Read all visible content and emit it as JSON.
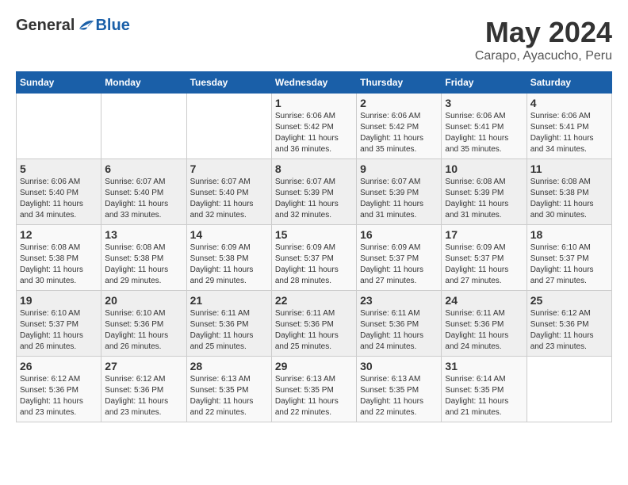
{
  "header": {
    "logo": {
      "general": "General",
      "blue": "Blue"
    },
    "title": "May 2024",
    "subtitle": "Carapo, Ayacucho, Peru"
  },
  "weekdays": [
    "Sunday",
    "Monday",
    "Tuesday",
    "Wednesday",
    "Thursday",
    "Friday",
    "Saturday"
  ],
  "weeks": [
    [
      {
        "day": "",
        "info": ""
      },
      {
        "day": "",
        "info": ""
      },
      {
        "day": "",
        "info": ""
      },
      {
        "day": "1",
        "info": "Sunrise: 6:06 AM\nSunset: 5:42 PM\nDaylight: 11 hours\nand 36 minutes."
      },
      {
        "day": "2",
        "info": "Sunrise: 6:06 AM\nSunset: 5:42 PM\nDaylight: 11 hours\nand 35 minutes."
      },
      {
        "day": "3",
        "info": "Sunrise: 6:06 AM\nSunset: 5:41 PM\nDaylight: 11 hours\nand 35 minutes."
      },
      {
        "day": "4",
        "info": "Sunrise: 6:06 AM\nSunset: 5:41 PM\nDaylight: 11 hours\nand 34 minutes."
      }
    ],
    [
      {
        "day": "5",
        "info": "Sunrise: 6:06 AM\nSunset: 5:40 PM\nDaylight: 11 hours\nand 34 minutes."
      },
      {
        "day": "6",
        "info": "Sunrise: 6:07 AM\nSunset: 5:40 PM\nDaylight: 11 hours\nand 33 minutes."
      },
      {
        "day": "7",
        "info": "Sunrise: 6:07 AM\nSunset: 5:40 PM\nDaylight: 11 hours\nand 32 minutes."
      },
      {
        "day": "8",
        "info": "Sunrise: 6:07 AM\nSunset: 5:39 PM\nDaylight: 11 hours\nand 32 minutes."
      },
      {
        "day": "9",
        "info": "Sunrise: 6:07 AM\nSunset: 5:39 PM\nDaylight: 11 hours\nand 31 minutes."
      },
      {
        "day": "10",
        "info": "Sunrise: 6:08 AM\nSunset: 5:39 PM\nDaylight: 11 hours\nand 31 minutes."
      },
      {
        "day": "11",
        "info": "Sunrise: 6:08 AM\nSunset: 5:38 PM\nDaylight: 11 hours\nand 30 minutes."
      }
    ],
    [
      {
        "day": "12",
        "info": "Sunrise: 6:08 AM\nSunset: 5:38 PM\nDaylight: 11 hours\nand 30 minutes."
      },
      {
        "day": "13",
        "info": "Sunrise: 6:08 AM\nSunset: 5:38 PM\nDaylight: 11 hours\nand 29 minutes."
      },
      {
        "day": "14",
        "info": "Sunrise: 6:09 AM\nSunset: 5:38 PM\nDaylight: 11 hours\nand 29 minutes."
      },
      {
        "day": "15",
        "info": "Sunrise: 6:09 AM\nSunset: 5:37 PM\nDaylight: 11 hours\nand 28 minutes."
      },
      {
        "day": "16",
        "info": "Sunrise: 6:09 AM\nSunset: 5:37 PM\nDaylight: 11 hours\nand 27 minutes."
      },
      {
        "day": "17",
        "info": "Sunrise: 6:09 AM\nSunset: 5:37 PM\nDaylight: 11 hours\nand 27 minutes."
      },
      {
        "day": "18",
        "info": "Sunrise: 6:10 AM\nSunset: 5:37 PM\nDaylight: 11 hours\nand 27 minutes."
      }
    ],
    [
      {
        "day": "19",
        "info": "Sunrise: 6:10 AM\nSunset: 5:37 PM\nDaylight: 11 hours\nand 26 minutes."
      },
      {
        "day": "20",
        "info": "Sunrise: 6:10 AM\nSunset: 5:36 PM\nDaylight: 11 hours\nand 26 minutes."
      },
      {
        "day": "21",
        "info": "Sunrise: 6:11 AM\nSunset: 5:36 PM\nDaylight: 11 hours\nand 25 minutes."
      },
      {
        "day": "22",
        "info": "Sunrise: 6:11 AM\nSunset: 5:36 PM\nDaylight: 11 hours\nand 25 minutes."
      },
      {
        "day": "23",
        "info": "Sunrise: 6:11 AM\nSunset: 5:36 PM\nDaylight: 11 hours\nand 24 minutes."
      },
      {
        "day": "24",
        "info": "Sunrise: 6:11 AM\nSunset: 5:36 PM\nDaylight: 11 hours\nand 24 minutes."
      },
      {
        "day": "25",
        "info": "Sunrise: 6:12 AM\nSunset: 5:36 PM\nDaylight: 11 hours\nand 23 minutes."
      }
    ],
    [
      {
        "day": "26",
        "info": "Sunrise: 6:12 AM\nSunset: 5:36 PM\nDaylight: 11 hours\nand 23 minutes."
      },
      {
        "day": "27",
        "info": "Sunrise: 6:12 AM\nSunset: 5:36 PM\nDaylight: 11 hours\nand 23 minutes."
      },
      {
        "day": "28",
        "info": "Sunrise: 6:13 AM\nSunset: 5:35 PM\nDaylight: 11 hours\nand 22 minutes."
      },
      {
        "day": "29",
        "info": "Sunrise: 6:13 AM\nSunset: 5:35 PM\nDaylight: 11 hours\nand 22 minutes."
      },
      {
        "day": "30",
        "info": "Sunrise: 6:13 AM\nSunset: 5:35 PM\nDaylight: 11 hours\nand 22 minutes."
      },
      {
        "day": "31",
        "info": "Sunrise: 6:14 AM\nSunset: 5:35 PM\nDaylight: 11 hours\nand 21 minutes."
      },
      {
        "day": "",
        "info": ""
      }
    ]
  ]
}
